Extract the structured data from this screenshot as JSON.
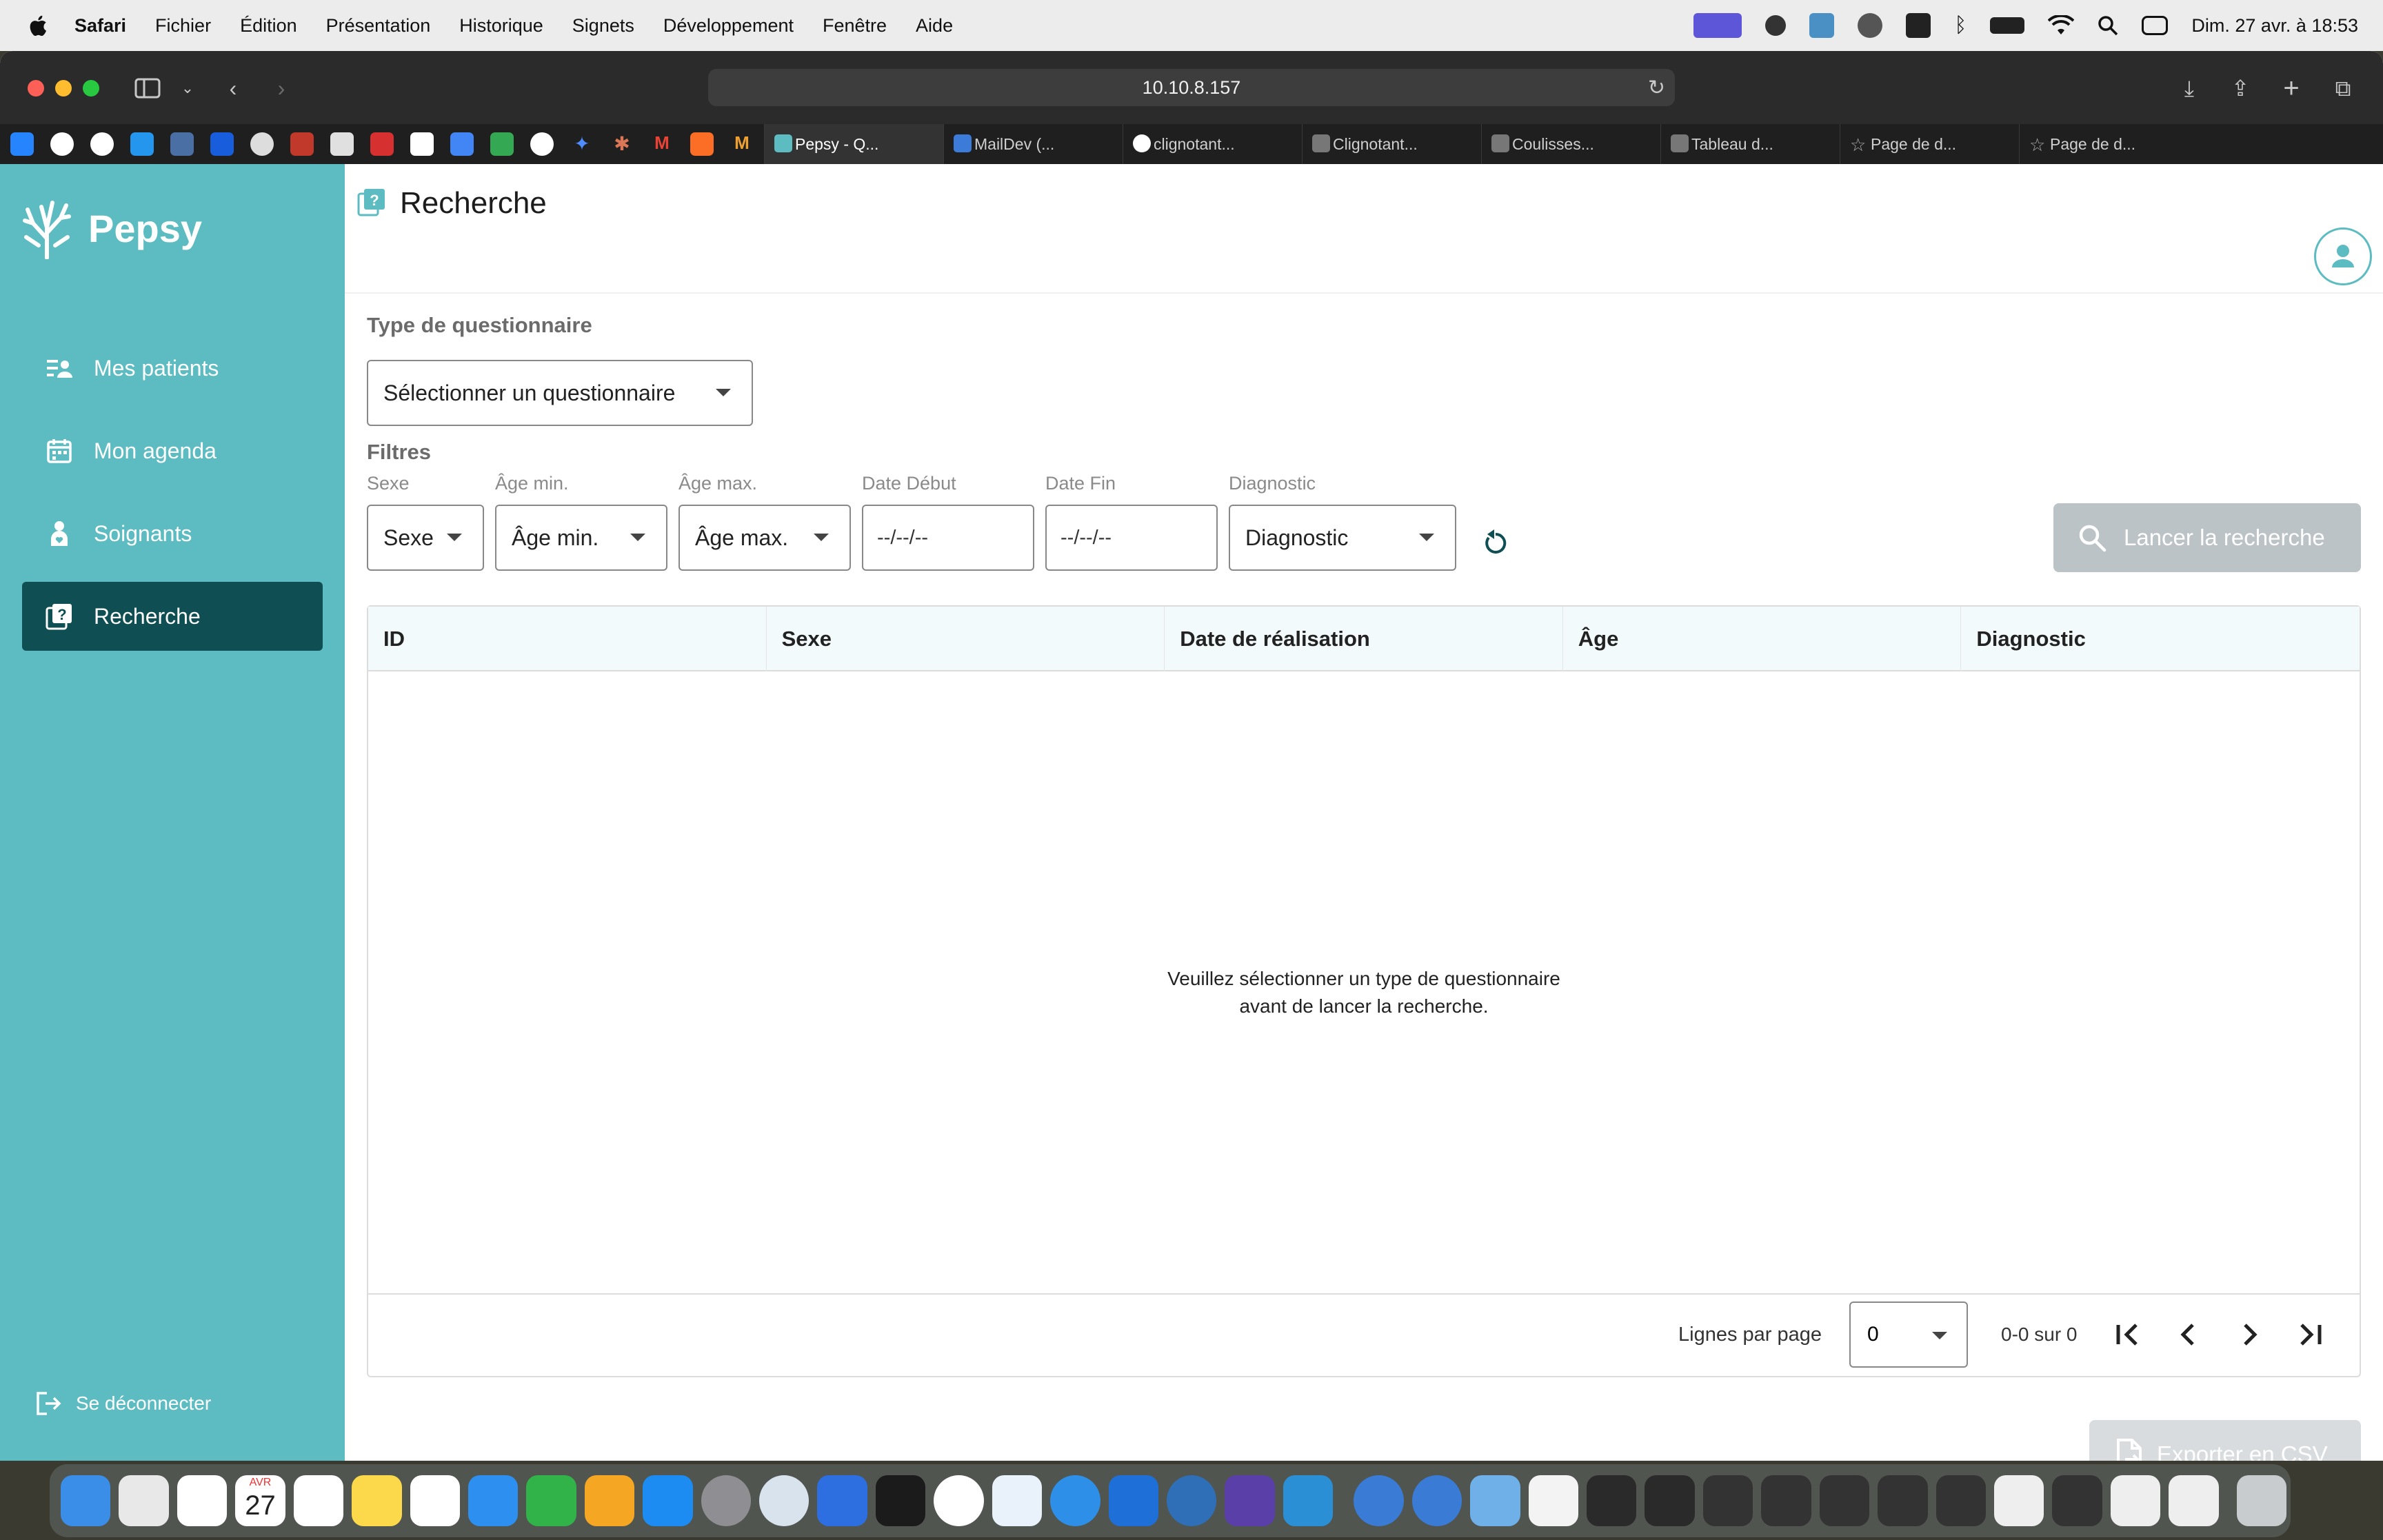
{
  "menubar": {
    "app": "Safari",
    "items": [
      "Fichier",
      "Édition",
      "Présentation",
      "Historique",
      "Signets",
      "Développement",
      "Fenêtre",
      "Aide"
    ],
    "clock": "Dim. 27 avr. à 18:53"
  },
  "browser": {
    "url": "10.10.8.157",
    "tabs": [
      {
        "label": "Pepsy - Q...",
        "active": true
      },
      {
        "label": "MailDev (...",
        "active": false
      },
      {
        "label": "clignotant...",
        "active": false
      },
      {
        "label": "Clignotant...",
        "active": false
      },
      {
        "label": "Coulisses...",
        "active": false
      },
      {
        "label": "Tableau d...",
        "active": false
      },
      {
        "label": "Page de d...",
        "active": false
      },
      {
        "label": "Page de d...",
        "active": false
      }
    ]
  },
  "sidebar": {
    "brand": "Pepsy",
    "items": [
      {
        "label": "Mes patients",
        "icon": "patients-icon"
      },
      {
        "label": "Mon agenda",
        "icon": "calendar-icon"
      },
      {
        "label": "Soignants",
        "icon": "caregiver-icon"
      },
      {
        "label": "Recherche",
        "icon": "search-doc-icon",
        "active": true
      }
    ],
    "logout": "Se déconnecter"
  },
  "page": {
    "title": "Recherche",
    "questionnaire_label": "Type de questionnaire",
    "questionnaire_select": "Sélectionner un questionnaire",
    "filters_label": "Filtres",
    "filters": {
      "sexe_label": "Sexe",
      "sexe_value": "Sexe",
      "age_min_label": "Âge min.",
      "age_min_value": "Âge min.",
      "age_max_label": "Âge max.",
      "age_max_value": "Âge max.",
      "date_debut_label": "Date Début",
      "date_debut_value": "--/--/--",
      "date_fin_label": "Date Fin",
      "date_fin_value": "--/--/--",
      "diagnostic_label": "Diagnostic",
      "diagnostic_value": "Diagnostic"
    },
    "search_button": "Lancer la recherche",
    "export_button": "Exporter en CSV"
  },
  "table": {
    "columns": [
      "ID",
      "Sexe",
      "Date de réalisation",
      "Âge",
      "Diagnostic"
    ],
    "empty_line1": "Veuillez sélectionner un type de questionnaire",
    "empty_line2": "avant de lancer la recherche.",
    "rows_per_page_label": "Lignes par page",
    "rows_per_page_value": "0",
    "range": "0-0 sur 0"
  },
  "colors": {
    "sidebar": "#5cbcc1",
    "sidebar_active": "#0f4e52",
    "button_disabled": "#bcc3c7"
  },
  "dock": {
    "calendar_month": "AVR",
    "calendar_day": "27"
  }
}
